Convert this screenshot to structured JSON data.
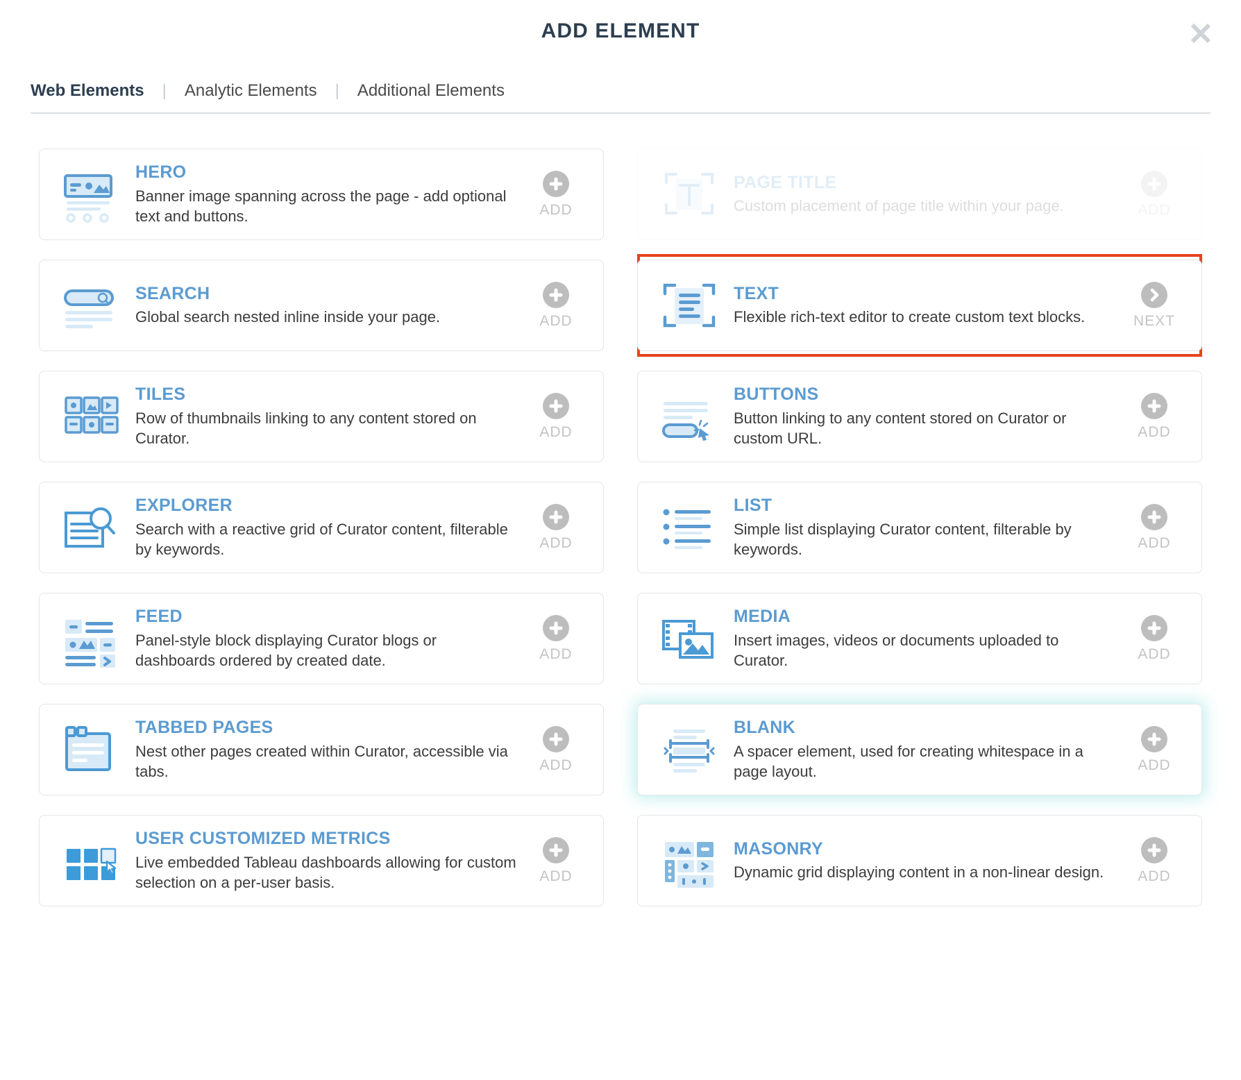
{
  "header": {
    "title": "ADD ELEMENT",
    "close_icon": "close-icon",
    "close_label": "✕"
  },
  "tabs": [
    {
      "label": "Web Elements",
      "active": true
    },
    {
      "label": "Analytic Elements",
      "active": false
    },
    {
      "label": "Additional Elements",
      "active": false
    }
  ],
  "tab_separator": "|",
  "colors": {
    "title": "#2d3e50",
    "card_title_blue": "#5b9bd1",
    "icon_blue": "#5b9bd1",
    "icon_blue_light": "#d8eaf7",
    "icon_blue_strong": "#3d9bd9",
    "selection_red": "#e8431f",
    "glow_teal": "#96e2e0",
    "action_gray": "#bdbdbd",
    "action_label_gray": "#c3c3c3",
    "card_border": "#e2e5e8"
  },
  "elements": [
    {
      "name": "HERO",
      "description": "Banner image spanning across the page - add optional text and buttons.",
      "icon": "hero-icon",
      "action": "ADD",
      "action_icon": "plus-icon",
      "state": "normal",
      "column": "left"
    },
    {
      "name": "PAGE TITLE",
      "description": "Custom placement of page title within your page.",
      "icon": "page-title-icon",
      "action": "ADD",
      "action_icon": "plus-icon",
      "state": "disabled",
      "column": "right"
    },
    {
      "name": "SEARCH",
      "description": "Global search nested inline inside your page.",
      "icon": "search-element-icon",
      "action": "ADD",
      "action_icon": "plus-icon",
      "state": "normal",
      "column": "left"
    },
    {
      "name": "TEXT",
      "description": "Flexible rich-text editor to create custom text blocks.",
      "icon": "text-icon",
      "action": "NEXT",
      "action_icon": "chevron-right-icon",
      "state": "selected",
      "column": "right"
    },
    {
      "name": "TILES",
      "description": "Row of thumbnails linking to any content stored on Curator.",
      "icon": "tiles-icon",
      "action": "ADD",
      "action_icon": "plus-icon",
      "state": "normal",
      "column": "left"
    },
    {
      "name": "BUTTONS",
      "description": "Button linking to any content stored on Curator or custom URL.",
      "icon": "buttons-icon",
      "action": "ADD",
      "action_icon": "plus-icon",
      "state": "normal",
      "column": "right"
    },
    {
      "name": "EXPLORER",
      "description": "Search with a reactive grid of Curator content, filterable by keywords.",
      "icon": "explorer-icon",
      "action": "ADD",
      "action_icon": "plus-icon",
      "state": "normal",
      "column": "left"
    },
    {
      "name": "LIST",
      "description": "Simple list displaying Curator content, filterable by keywords.",
      "icon": "list-icon",
      "action": "ADD",
      "action_icon": "plus-icon",
      "state": "normal",
      "column": "right"
    },
    {
      "name": "FEED",
      "description": "Panel-style block displaying Curator blogs or dashboards ordered by created date.",
      "icon": "feed-icon",
      "action": "ADD",
      "action_icon": "plus-icon",
      "state": "normal",
      "column": "left"
    },
    {
      "name": "MEDIA",
      "description": "Insert images, videos or documents uploaded to Curator.",
      "icon": "media-icon",
      "action": "ADD",
      "action_icon": "plus-icon",
      "state": "normal",
      "column": "right"
    },
    {
      "name": "TABBED PAGES",
      "description": "Nest other pages created within Curator, accessible via tabs.",
      "icon": "tabbed-pages-icon",
      "action": "ADD",
      "action_icon": "plus-icon",
      "state": "normal",
      "column": "left"
    },
    {
      "name": "BLANK",
      "description": "A spacer element, used for creating whitespace in a page layout.",
      "icon": "blank-icon",
      "action": "ADD",
      "action_icon": "plus-icon",
      "state": "hover",
      "column": "right"
    },
    {
      "name": "USER CUSTOMIZED METRICS",
      "description": "Live embedded Tableau dashboards allowing for custom selection on a per-user basis.",
      "icon": "user-customized-metrics-icon",
      "action": "ADD",
      "action_icon": "plus-icon",
      "state": "normal",
      "column": "left"
    },
    {
      "name": "MASONRY",
      "description": "Dynamic grid displaying content in a non-linear design.",
      "icon": "masonry-icon",
      "action": "ADD",
      "action_icon": "plus-icon",
      "state": "normal",
      "column": "right"
    }
  ]
}
